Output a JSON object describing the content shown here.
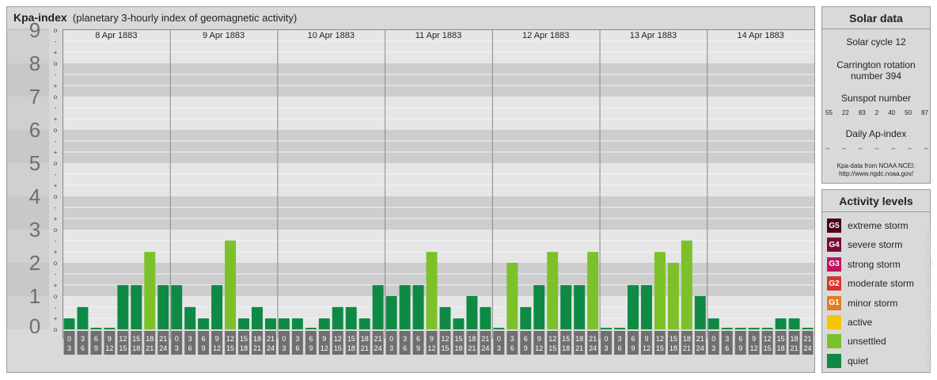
{
  "header": {
    "title": "Kpa-index",
    "subtitle": "(planetary 3-hourly index of geomagnetic activity)"
  },
  "chart_data": {
    "type": "bar",
    "title": "Kpa-index",
    "subtitle": "(planetary 3-hourly index of geomagnetic activity)",
    "ylim": [
      0,
      9
    ],
    "y_ticks": [
      "0",
      "1",
      "2",
      "3",
      "4",
      "5",
      "6",
      "7",
      "8",
      "9"
    ],
    "minor_ticks": [
      "+",
      "o",
      "-"
    ],
    "days": [
      "8 Apr 1883",
      "9 Apr 1883",
      "10 Apr 1883",
      "11 Apr 1883",
      "12 Apr 1883",
      "13 Apr 1883",
      "14 Apr 1883"
    ],
    "hour_starts": [
      "0",
      "3",
      "6",
      "9",
      "12",
      "15",
      "18",
      "21"
    ],
    "hour_ends": [
      "3",
      "6",
      "9",
      "12",
      "15",
      "18",
      "21",
      "24"
    ],
    "values": [
      [
        0.33,
        0.67,
        0,
        0,
        1.33,
        1.33,
        2.33,
        1.33
      ],
      [
        1.33,
        0.67,
        0.33,
        1.33,
        2.67,
        0.33,
        0.67,
        0.33
      ],
      [
        0.33,
        0.33,
        0,
        0.33,
        0.67,
        0.67,
        0.33,
        1.33
      ],
      [
        1,
        1.33,
        1.33,
        2.33,
        0.67,
        0.33,
        1,
        0.67
      ],
      [
        0,
        2,
        0.67,
        1.33,
        2.33,
        1.33,
        1.33,
        2.33
      ],
      [
        0,
        0,
        1.33,
        1.33,
        2.33,
        2,
        2.67,
        1
      ],
      [
        0.33,
        0,
        0,
        0,
        0,
        0.33,
        0.33,
        0
      ]
    ],
    "colors": {
      "quiet": "#0e8a45",
      "unsettled": "#7cc12a"
    }
  },
  "solar": {
    "title": "Solar data",
    "cycle": "Solar cycle 12",
    "carrington_line1": "Carrington rotation",
    "carrington_line2": "number 394",
    "sunspot_label": "Sunspot number",
    "sunspots": [
      "55",
      "22",
      "83",
      "2",
      "40",
      "50",
      "87"
    ],
    "ap_label": "Daily Ap-index",
    "ap_values": [
      "--",
      "--",
      "--",
      "--",
      "--",
      "--",
      "--"
    ],
    "credit_line1": "Kpa-data from NOAA NCEI:",
    "credit_line2": "http://www.ngdc.noaa.gov/"
  },
  "levels": {
    "title": "Activity levels",
    "items": [
      {
        "code": "G5",
        "label": "extreme storm",
        "color": "#4a0020"
      },
      {
        "code": "G4",
        "label": "severe storm",
        "color": "#7a0a38"
      },
      {
        "code": "G3",
        "label": "strong storm",
        "color": "#c0155e"
      },
      {
        "code": "G2",
        "label": "moderate storm",
        "color": "#d8352a"
      },
      {
        "code": "G1",
        "label": "minor storm",
        "color": "#e57c22"
      },
      {
        "code": "",
        "label": "active",
        "color": "#f7c400"
      },
      {
        "code": "",
        "label": "unsettled",
        "color": "#7cc12a"
      },
      {
        "code": "",
        "label": "quiet",
        "color": "#0e8a45"
      }
    ]
  },
  "watermark": "http://www.tesis.lebedev.ru/en/sun_flares.html"
}
